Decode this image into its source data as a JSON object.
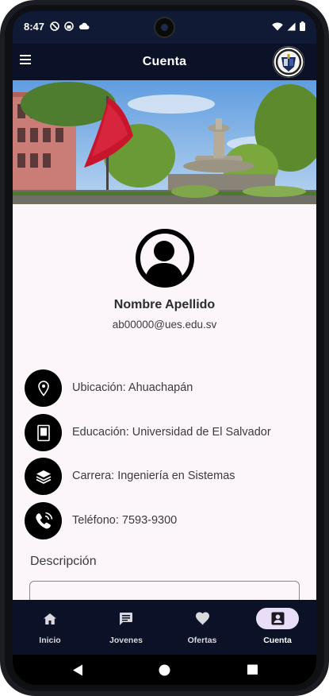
{
  "status_bar": {
    "time": "8:47",
    "left_icons": [
      "do-not-disturb-icon",
      "vpn-icon",
      "cloud-icon"
    ],
    "right_icons": [
      "wifi-icon",
      "signal-icon",
      "battery-icon"
    ]
  },
  "app_bar": {
    "title": "Cuenta",
    "menu_icon": "hamburger-menu-icon",
    "logo_icon": "university-logo"
  },
  "profile": {
    "name": "Nombre Apellido",
    "email": "ab00000@ues.edu.sv",
    "avatar_icon": "account-circle-icon"
  },
  "info_items": [
    {
      "icon": "location-pin-icon",
      "text": "Ubicación: Ahuachapán"
    },
    {
      "icon": "book-icon",
      "text": "Educación: Universidad de El Salvador"
    },
    {
      "icon": "layers-icon",
      "text": "Carrera: Ingeniería en Sistemas"
    },
    {
      "icon": "phone-ringing-icon",
      "text": "Teléfono: 7593-9300"
    }
  ],
  "description": {
    "label": "Descripción",
    "value": ""
  },
  "bottom_nav": {
    "items": [
      {
        "label": "Inicio",
        "icon": "home-icon",
        "active": false
      },
      {
        "label": "Jovenes",
        "icon": "chat-icon",
        "active": false
      },
      {
        "label": "Ofertas",
        "icon": "heart-icon",
        "active": false
      },
      {
        "label": "Cuenta",
        "icon": "account-box-icon",
        "active": true
      }
    ]
  },
  "system_nav": [
    "back-icon",
    "home-circle-icon",
    "recents-icon"
  ],
  "colors": {
    "app_bar": "#0b1127",
    "content_bg": "#fcf6fb",
    "active_pill": "#e8def8",
    "icon_bg": "#000000"
  }
}
